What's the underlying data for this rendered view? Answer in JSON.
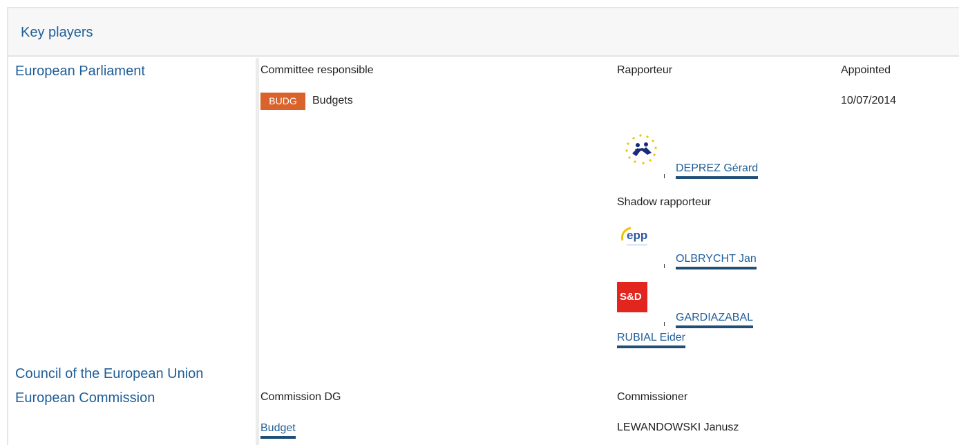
{
  "section": {
    "title": "Key players"
  },
  "institutions": {
    "european_parliament": "European Parliament",
    "council": "Council of the European Union",
    "commission": "European Commission"
  },
  "parliament": {
    "col_committee": "Committee responsible",
    "col_rapporteur": "Rapporteur",
    "col_appointed": "Appointed",
    "committee_code": "BUDG",
    "committee_name": "Budgets",
    "appointed_date": "10/07/2014",
    "rapporteur": {
      "name": "DEPREZ Gérard",
      "group_icon": "alde-group-logo"
    },
    "shadow_label": "Shadow rapporteur",
    "shadows": [
      {
        "name": "OLBRYCHT Jan",
        "group_icon": "epp-group-logo",
        "logo_text": "epp"
      },
      {
        "name_line1": "GARDIAZABAL",
        "name_line2": "RUBIAL Eider",
        "group_icon": "sd-group-logo",
        "logo_text": "S&D"
      }
    ]
  },
  "commission": {
    "col_dg": "Commission DG",
    "col_commissioner": "Commissioner",
    "dg": "Budget",
    "commissioner": "LEWANDOWSKI Janusz"
  },
  "colors": {
    "link": "#1f5e99",
    "badge": "#d9632b",
    "sd_red": "#e3251f"
  }
}
